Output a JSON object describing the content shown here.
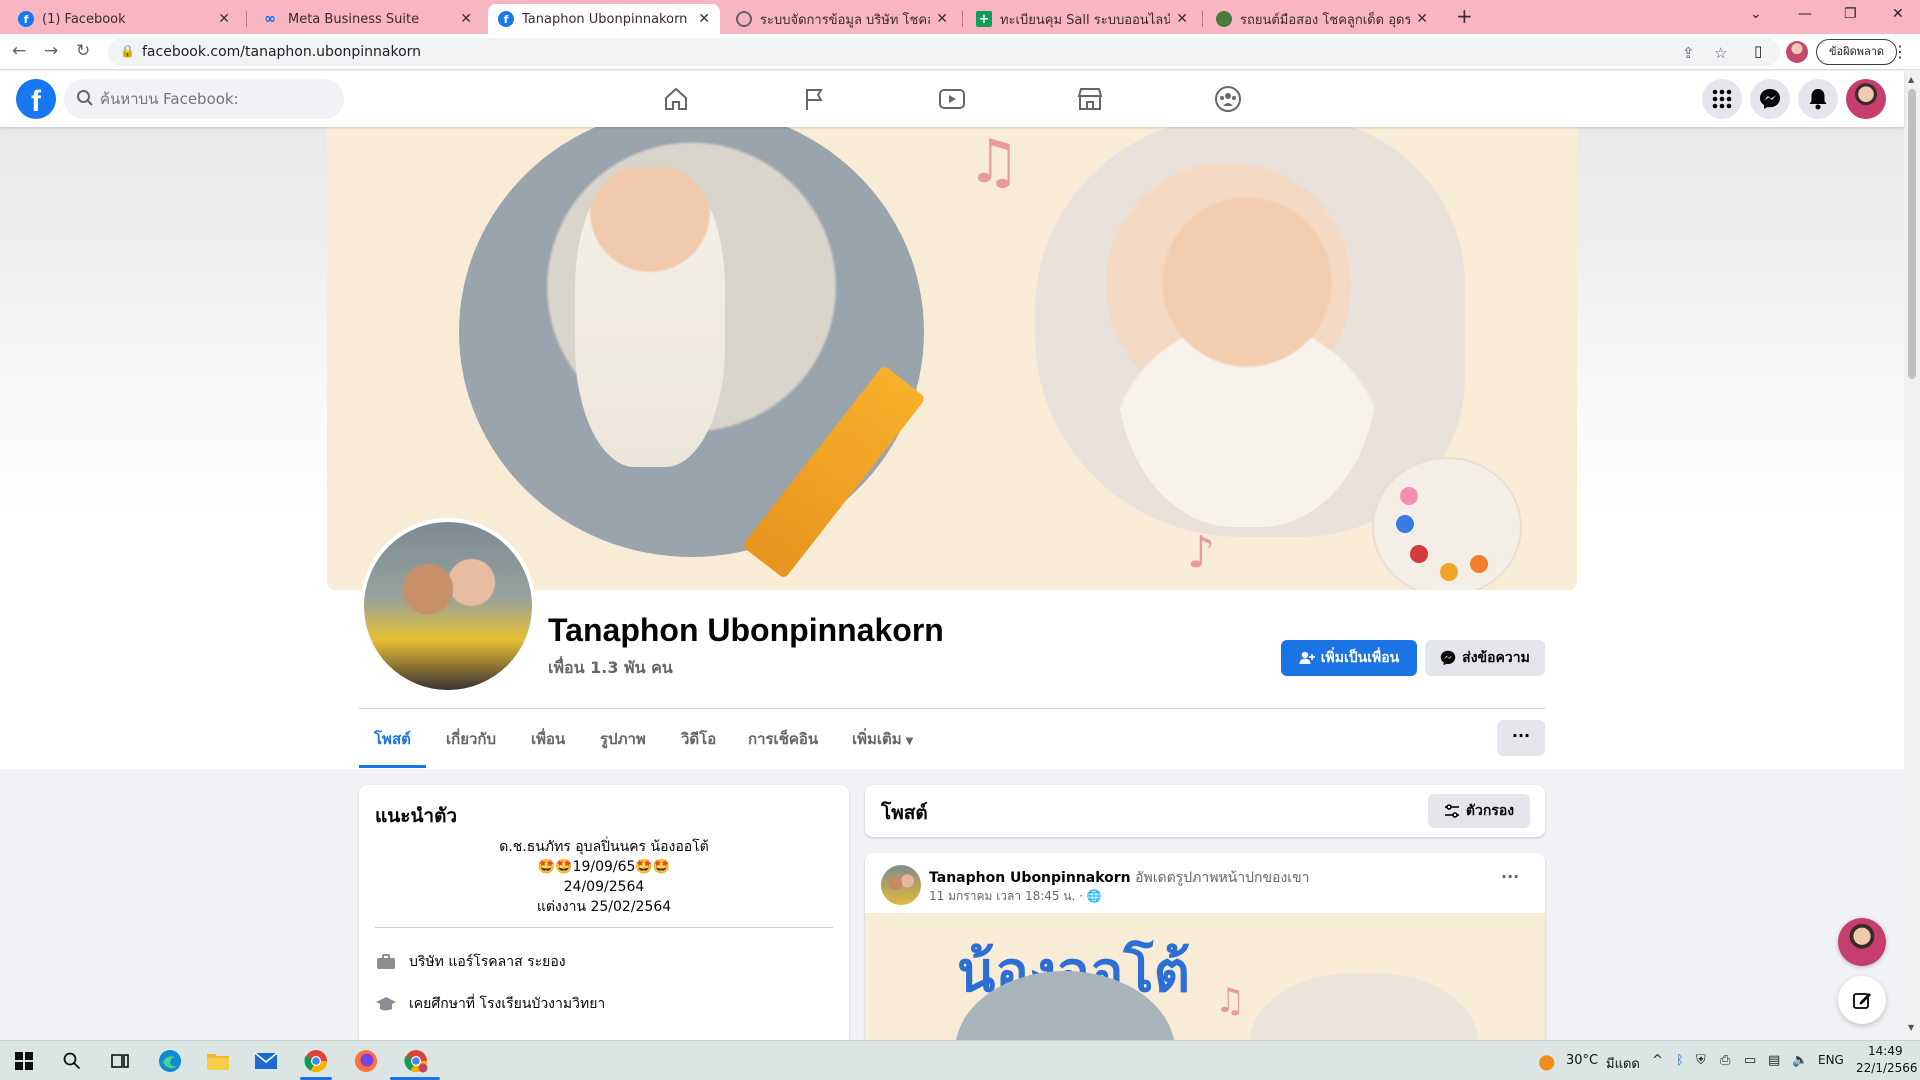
{
  "browser": {
    "tabs": [
      {
        "title": "(1) Facebook",
        "favicon": "facebook-icon",
        "color": "#1877f2"
      },
      {
        "title": "Meta Business Suite",
        "favicon": "meta-icon",
        "color": "#0866ff"
      },
      {
        "title": "Tanaphon Ubonpinnakorn | Faceb",
        "favicon": "facebook-icon",
        "color": "#1877f2",
        "active": true
      },
      {
        "title": "ระบบจัดการข้อมูล บริษัท โชคลูกเด็ด ห",
        "favicon": "globe-icon",
        "color": "#5f6368"
      },
      {
        "title": "ทะเบียนคุม Sall ระบบออนไลน์.xlsx - G",
        "favicon": "sheets-icon",
        "color": "#0f9d58"
      },
      {
        "title": "รถยนต์มือสอง โชคลูกเด็ด อุดรธานี",
        "favicon": "site-icon",
        "color": "#4a7a3a"
      }
    ],
    "url": "facebook.com/tanaphon.ubonpinnakorn",
    "error_button": "ข้อผิดพลาด"
  },
  "fb": {
    "search_placeholder": "ค้นหาบน Facebook:",
    "accent": "#1877f2"
  },
  "profile": {
    "name": "Tanaphon Ubonpinnakorn",
    "friends": "เพื่อน 1.3 พัน คน",
    "add_friend": "เพิ่มเป็นเพื่อน",
    "send_message": "ส่งข้อความ",
    "tabs": [
      "โพสต์",
      "เกี่ยวกับ",
      "เพื่อน",
      "รูปภาพ",
      "วิดีโอ",
      "การเช็คอิน",
      "เพิ่มเติม"
    ],
    "more_button": "···"
  },
  "intro": {
    "title": "แนะนำตัว",
    "bio": [
      "ด.ช.ธนภัทร อุบลปิ่นนคร น้องออโต้",
      "🤩🤩19/09/65🤩🤩",
      "24/09/2564",
      "แต่งงาน 25/02/2564"
    ],
    "work": "บริษัท แอร์โรคลาส ระยอง",
    "education": "เคยศึกษาที่ โรงเรียนบัวงามวิทยา"
  },
  "posts": {
    "title": "โพสต์",
    "filter": "ตัวกรอง",
    "first": {
      "author": "Tanaphon Ubonpinnakorn",
      "action": "อัพเดตรูปภาพหน้าปกของเขา",
      "time": "11 มกราคม เวลา 18:45 น. ·",
      "image_text": "น้องออโต้"
    }
  },
  "taskbar": {
    "weather": "30°C",
    "weather_desc": "มีแดด",
    "lang": "ENG",
    "time": "14:49",
    "date": "22/1/2566"
  }
}
